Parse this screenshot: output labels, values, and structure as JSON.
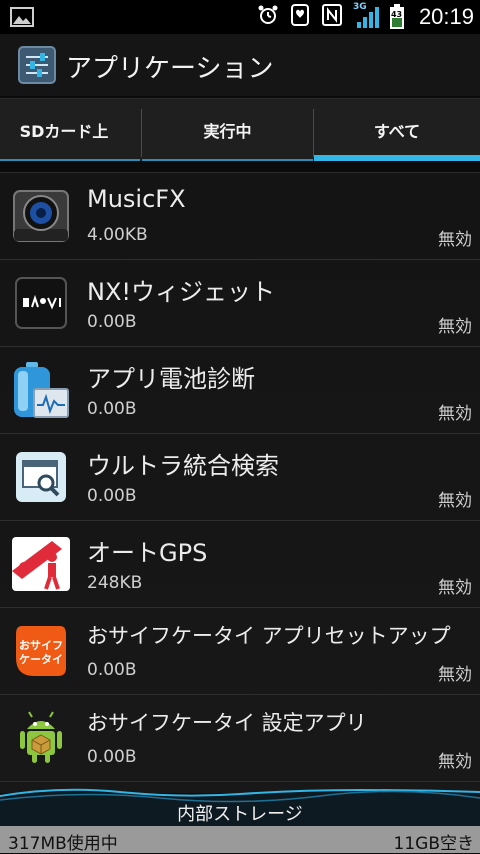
{
  "status_bar": {
    "clock": "20:19",
    "network": "3G",
    "battery": "43"
  },
  "action_bar": {
    "title": "アプリケーション",
    "icon": "settings-sliders-icon"
  },
  "tabs": [
    {
      "label": "SDカード上",
      "active": false
    },
    {
      "label": "実行中",
      "active": false
    },
    {
      "label": "すべて",
      "active": true
    }
  ],
  "apps": [
    {
      "name": "MusicFX",
      "size": "4.00KB",
      "status": "無効",
      "icon": "speaker-icon"
    },
    {
      "name": "NX!ウィジェット",
      "size": "0.00B",
      "status": "無効",
      "icon": "nx-widget-icon"
    },
    {
      "name": "アプリ電池診断",
      "size": "0.00B",
      "status": "無効",
      "icon": "battery-diagnosis-icon"
    },
    {
      "name": "ウルトラ統合検索",
      "size": "0.00B",
      "status": "無効",
      "icon": "search-window-icon"
    },
    {
      "name": "オートGPS",
      "size": "248KB",
      "status": "無効",
      "icon": "auto-gps-icon"
    },
    {
      "name": "おサイフケータイ アプリセットアップ",
      "size": "0.00B",
      "status": "無効",
      "icon": "osaifu-keitai-icon",
      "icon_text": [
        "おサイフ",
        "ケータイ"
      ]
    },
    {
      "name": "おサイフケータイ 設定アプリ",
      "size": "0.00B",
      "status": "無効",
      "icon": "android-icon"
    }
  ],
  "storage": {
    "label": "内部ストレージ",
    "used": "317MB使用中",
    "free": "11GB空き"
  },
  "colors": {
    "accent": "#33b5e5",
    "background": "#0b0b0b",
    "storage_bar": "#9a9a9a"
  }
}
